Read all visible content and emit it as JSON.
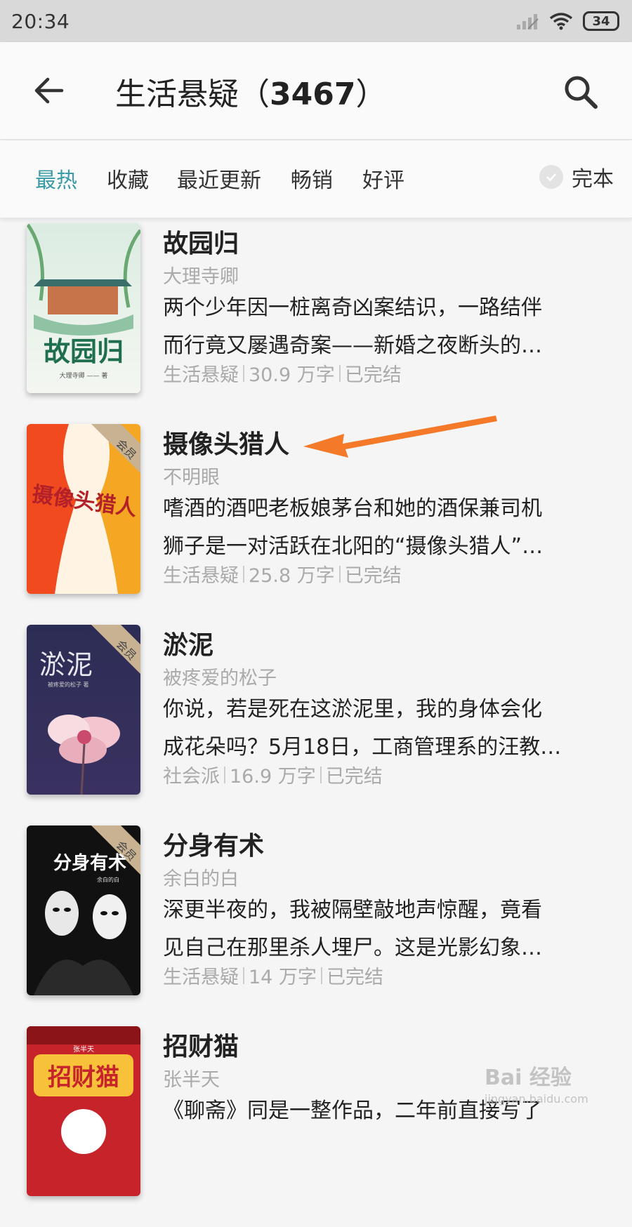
{
  "status_bar": {
    "time": "20:34",
    "battery": "34"
  },
  "header": {
    "title_text": "生活悬疑（",
    "title_count": "3467",
    "title_close": "）"
  },
  "filters": {
    "tabs": [
      {
        "label": "最热",
        "active": true
      },
      {
        "label": "收藏"
      },
      {
        "label": "最近更新"
      },
      {
        "label": "畅销"
      },
      {
        "label": "好评"
      }
    ],
    "complete_label": "完本"
  },
  "books": [
    {
      "title": "故园归",
      "author": "大理寺卿",
      "desc_line1": "两个少年因一桩离奇凶案结识，一路结伴",
      "desc_line2": "而行竟又屡遇奇案——新婚之夜断头的…",
      "category": "生活悬疑",
      "words": "30.9 万字",
      "status": "已完结",
      "cover_text": "故园归",
      "cover_author": "大理寺卿 —— 著"
    },
    {
      "title": "摄像头猎人",
      "author": "不明眼",
      "desc_line1": "嗜酒的酒吧老板娘茅台和她的酒保兼司机",
      "desc_line2": "狮子是一对活跃在北阳的“摄像头猎人”…",
      "category": "生活悬疑",
      "words": "25.8 万字",
      "status": "已完结",
      "cover_text": "摄像头猎人",
      "badge": "会员"
    },
    {
      "title": "淤泥",
      "author": "被疼爱的松子",
      "desc_line1": "你说，若是死在这淤泥里，我的身体会化",
      "desc_line2": "成花朵吗？5月18日，工商管理系的汪教…",
      "category": "社会派",
      "words": "16.9 万字",
      "status": "已完结",
      "cover_text": "淤泥",
      "cover_author": "被疼爱的松子 著",
      "badge": "会员"
    },
    {
      "title": "分身有术",
      "author": "余白的白",
      "desc_line1": "深更半夜的，我被隔壁敲地声惊醒，竟看",
      "desc_line2": "见自己在那里杀人埋尸。这是光影幻象…",
      "category": "生活悬疑",
      "words": "14 万字",
      "status": "已完结",
      "cover_text": "分身有术",
      "cover_author": "余白的白",
      "badge": "会员"
    },
    {
      "title": "招财猫",
      "author": "张半天",
      "desc_line1": "《聊斋》同是一整作品，二年前直接写了",
      "desc_line2": "",
      "category": "",
      "words": "",
      "status": "",
      "cover_text": "招财猫",
      "cover_author": "张半天"
    }
  ],
  "watermark": {
    "main": "Bai 经验",
    "sub": "jingyan.baidu.com"
  },
  "colors": {
    "accent": "#3a9aa6",
    "arrow": "#f47a2a",
    "muted": "#aaaaaa"
  }
}
